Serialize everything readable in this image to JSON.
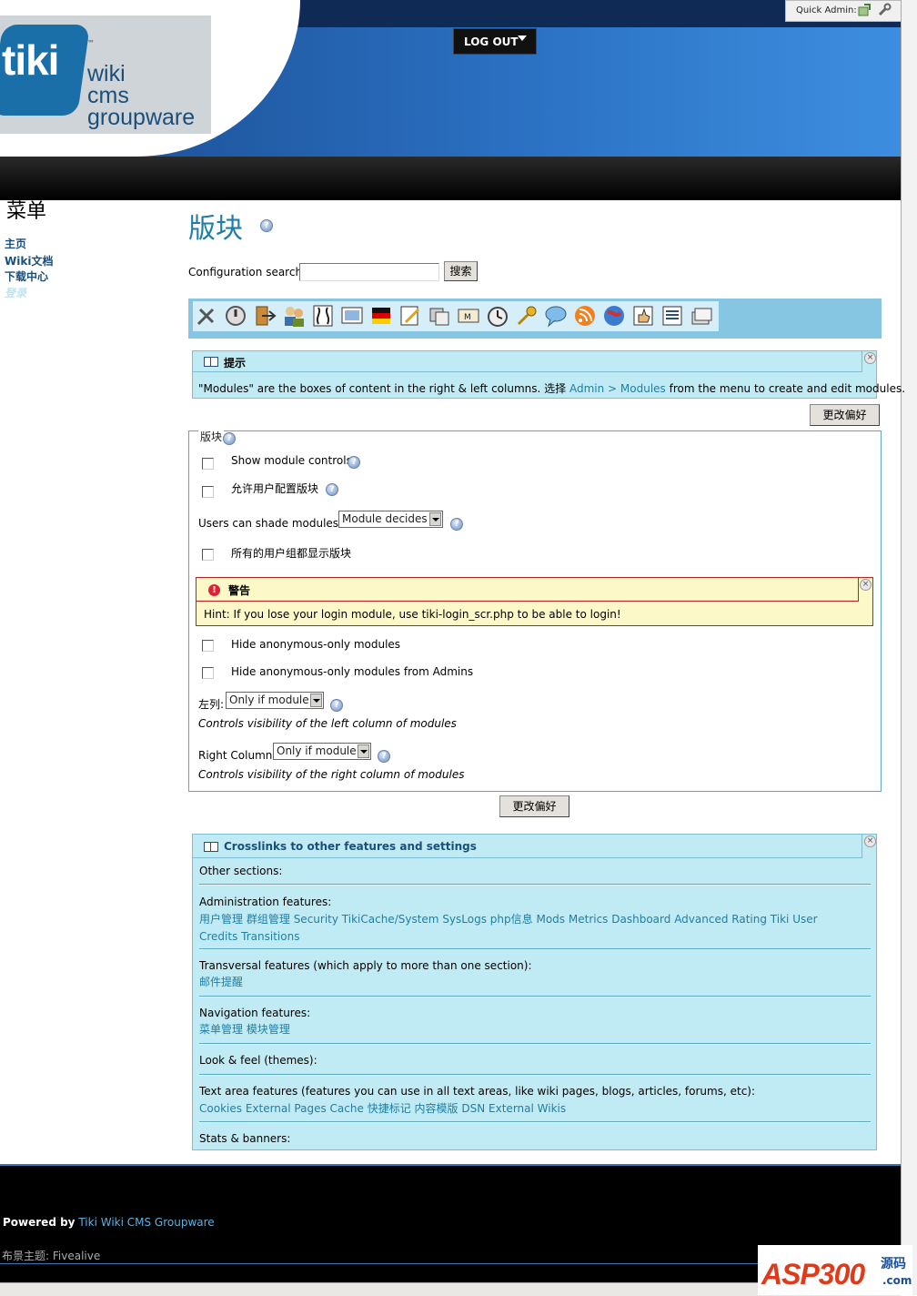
{
  "header": {
    "logo": {
      "word": "tiki",
      "tm": "™",
      "lines": [
        "wiki",
        "cms",
        "groupware"
      ]
    },
    "quick_admin_label": "Quick Admin:",
    "logout_label": "LOG OUT"
  },
  "sidebar": {
    "title": "菜单",
    "items": [
      {
        "label": "主页"
      },
      {
        "label": "Wiki文档"
      },
      {
        "label": "下载中心"
      },
      {
        "label": "登录"
      }
    ]
  },
  "main": {
    "title": "版块",
    "config_search": {
      "label": "Configuration search:",
      "value": "",
      "button": "搜索"
    },
    "tip_box": {
      "title": "提示",
      "text_before": "\"Modules\" are the boxes of content in the right & left columns. 选择",
      "link": "Admin > Modules",
      "text_after": "from the menu to create and edit modules."
    },
    "change_prefs_label": "更改偏好",
    "fieldset": {
      "legend": "版块",
      "show_module_controls": "Show module controls",
      "allow_user_config": "允许用户配置版块",
      "shade_label": "Users can shade modules:",
      "shade_value": "Module decides",
      "all_groups_show": "所有的用户组都显示版块",
      "warning": {
        "title": "警告",
        "text": "Hint: If you lose your login module, use tiki-login_scr.php to be able to login!"
      },
      "hide_anon": "Hide anonymous-only modules",
      "hide_anon_admins": "Hide anonymous-only modules from Admins",
      "left_col_label": "左列:",
      "left_col_value": "Only if module",
      "left_col_desc": "Controls visibility of the left column of modules",
      "right_col_label": "Right Column:",
      "right_col_value": "Only if module",
      "right_col_desc": "Controls visibility of the right column of modules"
    },
    "crosslinks": {
      "title": "Crosslinks to other features and settings",
      "other_sections": "Other sections:",
      "admin_features": "Administration features:",
      "admin_links": [
        "用户管理",
        "群组管理",
        "Security",
        "TikiCache/System",
        "SysLogs",
        "php信息",
        "Mods",
        "Metrics Dashboard",
        "Advanced Rating",
        "Tiki User Credits",
        "Transitions"
      ],
      "transversal": "Transversal features (which apply to more than one section):",
      "transversal_links": [
        "邮件提醒"
      ],
      "navigation": "Navigation features:",
      "navigation_links": [
        "菜单管理",
        "模块管理"
      ],
      "look_feel": "Look & feel (themes):",
      "text_area": "Text area features (features you can use in all text areas, like wiki pages, blogs, articles, forums, etc):",
      "text_area_links": [
        "Cookies",
        "External Pages Cache",
        "快捷标记",
        "内容模版",
        "DSN",
        "External Wikis"
      ],
      "stats": "Stats & banners:"
    }
  },
  "footer": {
    "powered_prefix": "Powered by",
    "powered_link": "Tiki Wiki CMS Groupware",
    "theme_label": "布景主题:",
    "theme_value": "Fivealive"
  },
  "watermark": {
    "brand": "ASP300",
    "suffix": "源码",
    "domain": ".com"
  },
  "colors": {
    "link": "#1e7ea5",
    "box_bg": "#c1ebf4",
    "header_dark": "#0f2a55",
    "warning_bg": "#fdf8c8",
    "warning_border": "#bb2222"
  }
}
